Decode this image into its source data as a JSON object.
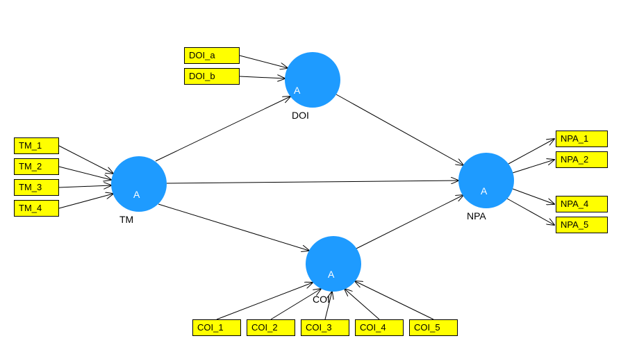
{
  "diagram": {
    "latent": {
      "tm": {
        "inner": "A",
        "label": "TM"
      },
      "doi": {
        "inner": "A",
        "label": "DOI"
      },
      "coi": {
        "inner": "A",
        "label": "COI"
      },
      "npa": {
        "inner": "A",
        "label": "NPA"
      }
    },
    "indicators": {
      "tm": [
        "TM_1",
        "TM_2",
        "TM_3",
        "TM_4"
      ],
      "doi": [
        "DOI_a",
        "DOI_b"
      ],
      "coi": [
        "COI_1",
        "COI_2",
        "COI_3",
        "COI_4",
        "COI_5"
      ],
      "npa": [
        "NPA_1",
        "NPA_2",
        "NPA_4",
        "NPA_5"
      ]
    },
    "structural_paths": [
      {
        "from": "TM",
        "to": "DOI"
      },
      {
        "from": "TM",
        "to": "COI"
      },
      {
        "from": "TM",
        "to": "NPA"
      },
      {
        "from": "DOI",
        "to": "NPA"
      },
      {
        "from": "COI",
        "to": "NPA"
      }
    ],
    "measurement_direction": {
      "tm": "indicators_to_latent",
      "doi": "indicators_to_latent",
      "coi": "indicators_to_latent",
      "npa": "latent_to_indicators"
    }
  }
}
